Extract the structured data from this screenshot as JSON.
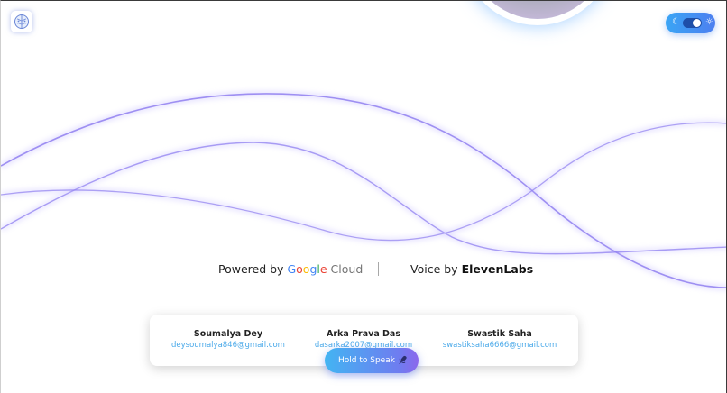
{
  "header": {
    "logo_icon": "brain-icon",
    "theme_toggle": {
      "left_icon": "moon-icon",
      "right_icon": "sun-icon",
      "moon_glyph": "☾",
      "sun_glyph": "☼",
      "state": "on"
    }
  },
  "credits": {
    "powered_prefix": "Powered by",
    "google_letters": [
      "G",
      "o",
      "o",
      "g",
      "l",
      "e"
    ],
    "google_colors": [
      "#4285F4",
      "#EA4335",
      "#FBBC05",
      "#4285F4",
      "#34A853",
      "#EA4335"
    ],
    "cloud_word": "Cloud",
    "voice_prefix": "Voice by",
    "voice_brand": "ElevenLabs"
  },
  "team": {
    "members": [
      {
        "name": "Soumalya Dey",
        "email": "deysoumalya846@gmail.com"
      },
      {
        "name": "Arka Prava Das",
        "email": "dasarka2007@gmail.com"
      },
      {
        "name": "Swastik Saha",
        "email": "swastiksaha6666@gmail.com"
      }
    ]
  },
  "controls": {
    "speak_label": "Hold to Speak",
    "speak_icon": "microphone-icon"
  },
  "colors": {
    "accent_blue": "#43b4f2",
    "accent_purple": "#8c68ec",
    "email_blue": "#4aa9e9",
    "wave_color": "#8f7ff0"
  }
}
